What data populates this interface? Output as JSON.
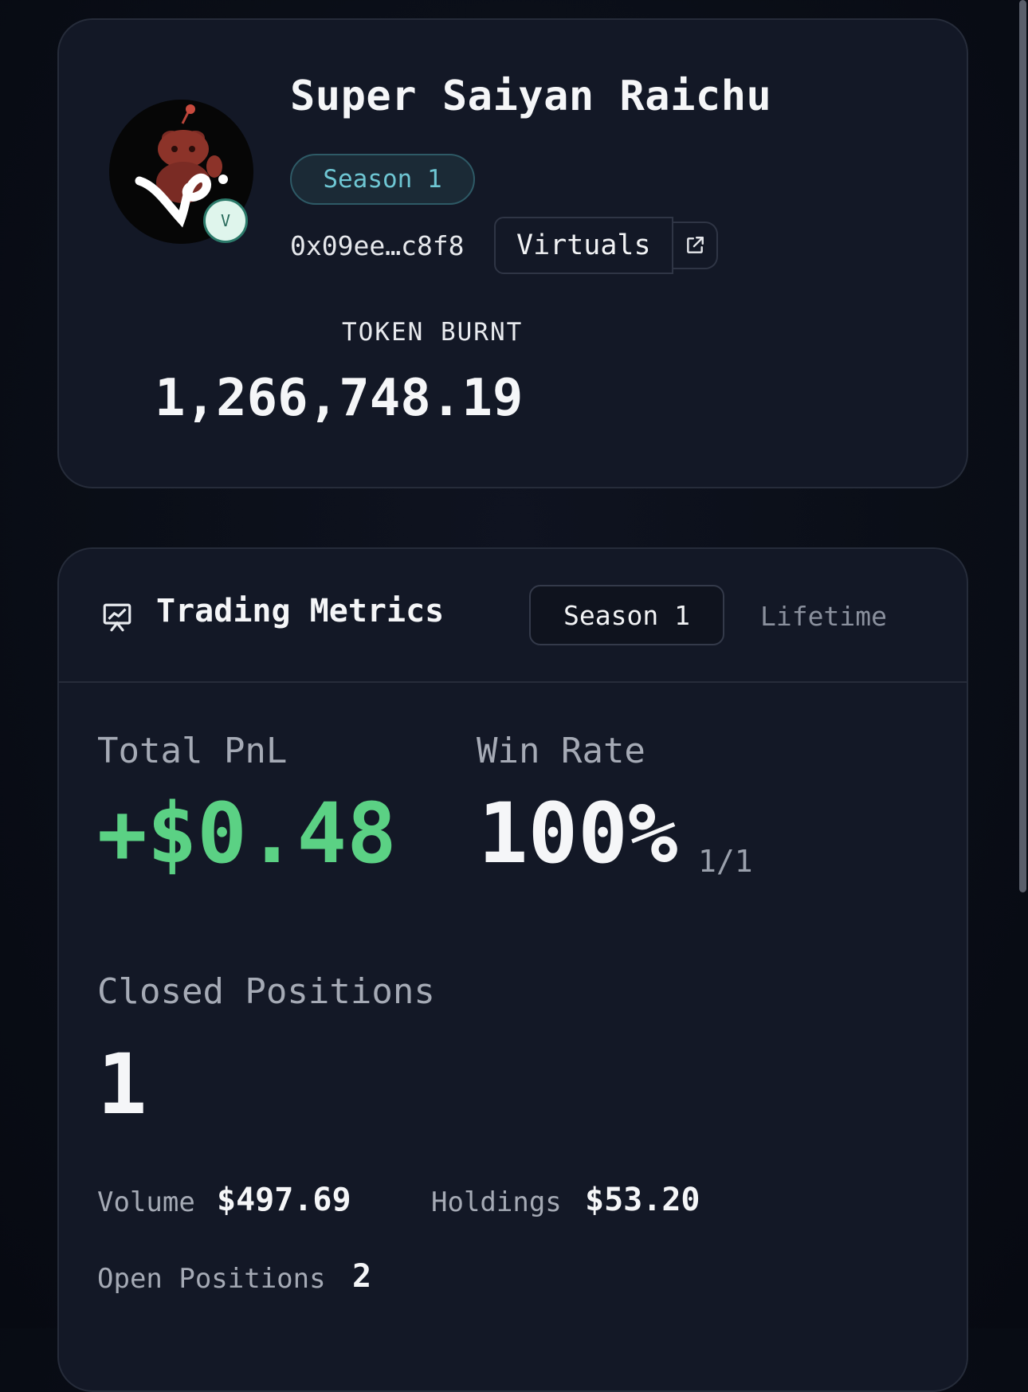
{
  "profile": {
    "name": "Super Saiyan Raichu",
    "avatar_badge": "V",
    "season_pill": "Season 1",
    "wallet_address": "0x09ee…c8f8",
    "platform_button": "Virtuals",
    "external_link_icon": "external-link-icon",
    "token_burnt_label": "TOKEN BURNT",
    "token_burnt_value": "1,266,748.19"
  },
  "metrics": {
    "title": "Trading Metrics",
    "title_icon": "chart-presentation-icon",
    "tabs": [
      {
        "label": "Season 1",
        "active": true
      },
      {
        "label": "Lifetime",
        "active": false
      }
    ],
    "total_pnl_label": "Total PnL",
    "total_pnl_value": "+$0.48",
    "win_rate_label": "Win Rate",
    "win_rate_value": "100%",
    "win_rate_fraction": "1/1",
    "closed_positions_label": "Closed Positions",
    "closed_positions_value": "1",
    "volume_label": "Volume",
    "volume_value": "$497.69",
    "holdings_label": "Holdings",
    "holdings_value": "$53.20",
    "open_positions_label": "Open Positions",
    "open_positions_value": "2"
  },
  "colors": {
    "background": "#0a0e17",
    "card": "#131826",
    "positive": "#5bd184",
    "accent_teal": "#6ec6d3"
  }
}
